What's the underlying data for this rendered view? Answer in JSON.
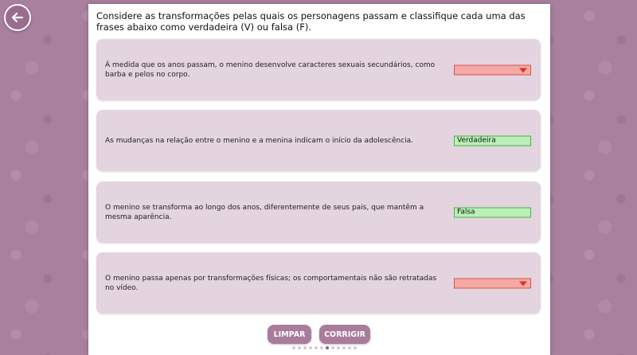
{
  "instructions": "Considere as transformações pelas quais os personagens passam e classifique cada uma das frases abaixo como verdadeira (V) ou falsa (F).",
  "cards": [
    {
      "text": "À medida que os anos passam, o menino desenvolve caracteres sexuais secundários, como barba e pelos no corpo.",
      "selected": ""
    },
    {
      "text": "As mudanças na relação entre o menino e a menina indicam o início da adolescência.",
      "selected": "Verdadeira"
    },
    {
      "text": "O menino se transforma ao longo dos anos, diferentemente de seus pais, que mantêm a mesma aparência.",
      "selected": "Falsa"
    },
    {
      "text": "O menino passa apenas por transformações físicas; os comportamentais não são retratadas no vídeo.",
      "selected": ""
    }
  ],
  "buttons": {
    "clear": "LIMPAR",
    "check": "CORRIGIR"
  },
  "pagination": {
    "total": 12,
    "current": 7
  },
  "icons": {
    "back": "arrow-left-icon",
    "dropdown": "chevron-down-icon"
  },
  "colors": {
    "background": "#a9819f",
    "card": "#e3d4e0",
    "button": "#a97b9c",
    "empty_select": "#f4a9a4",
    "filled_select": "#b9f0b5"
  }
}
